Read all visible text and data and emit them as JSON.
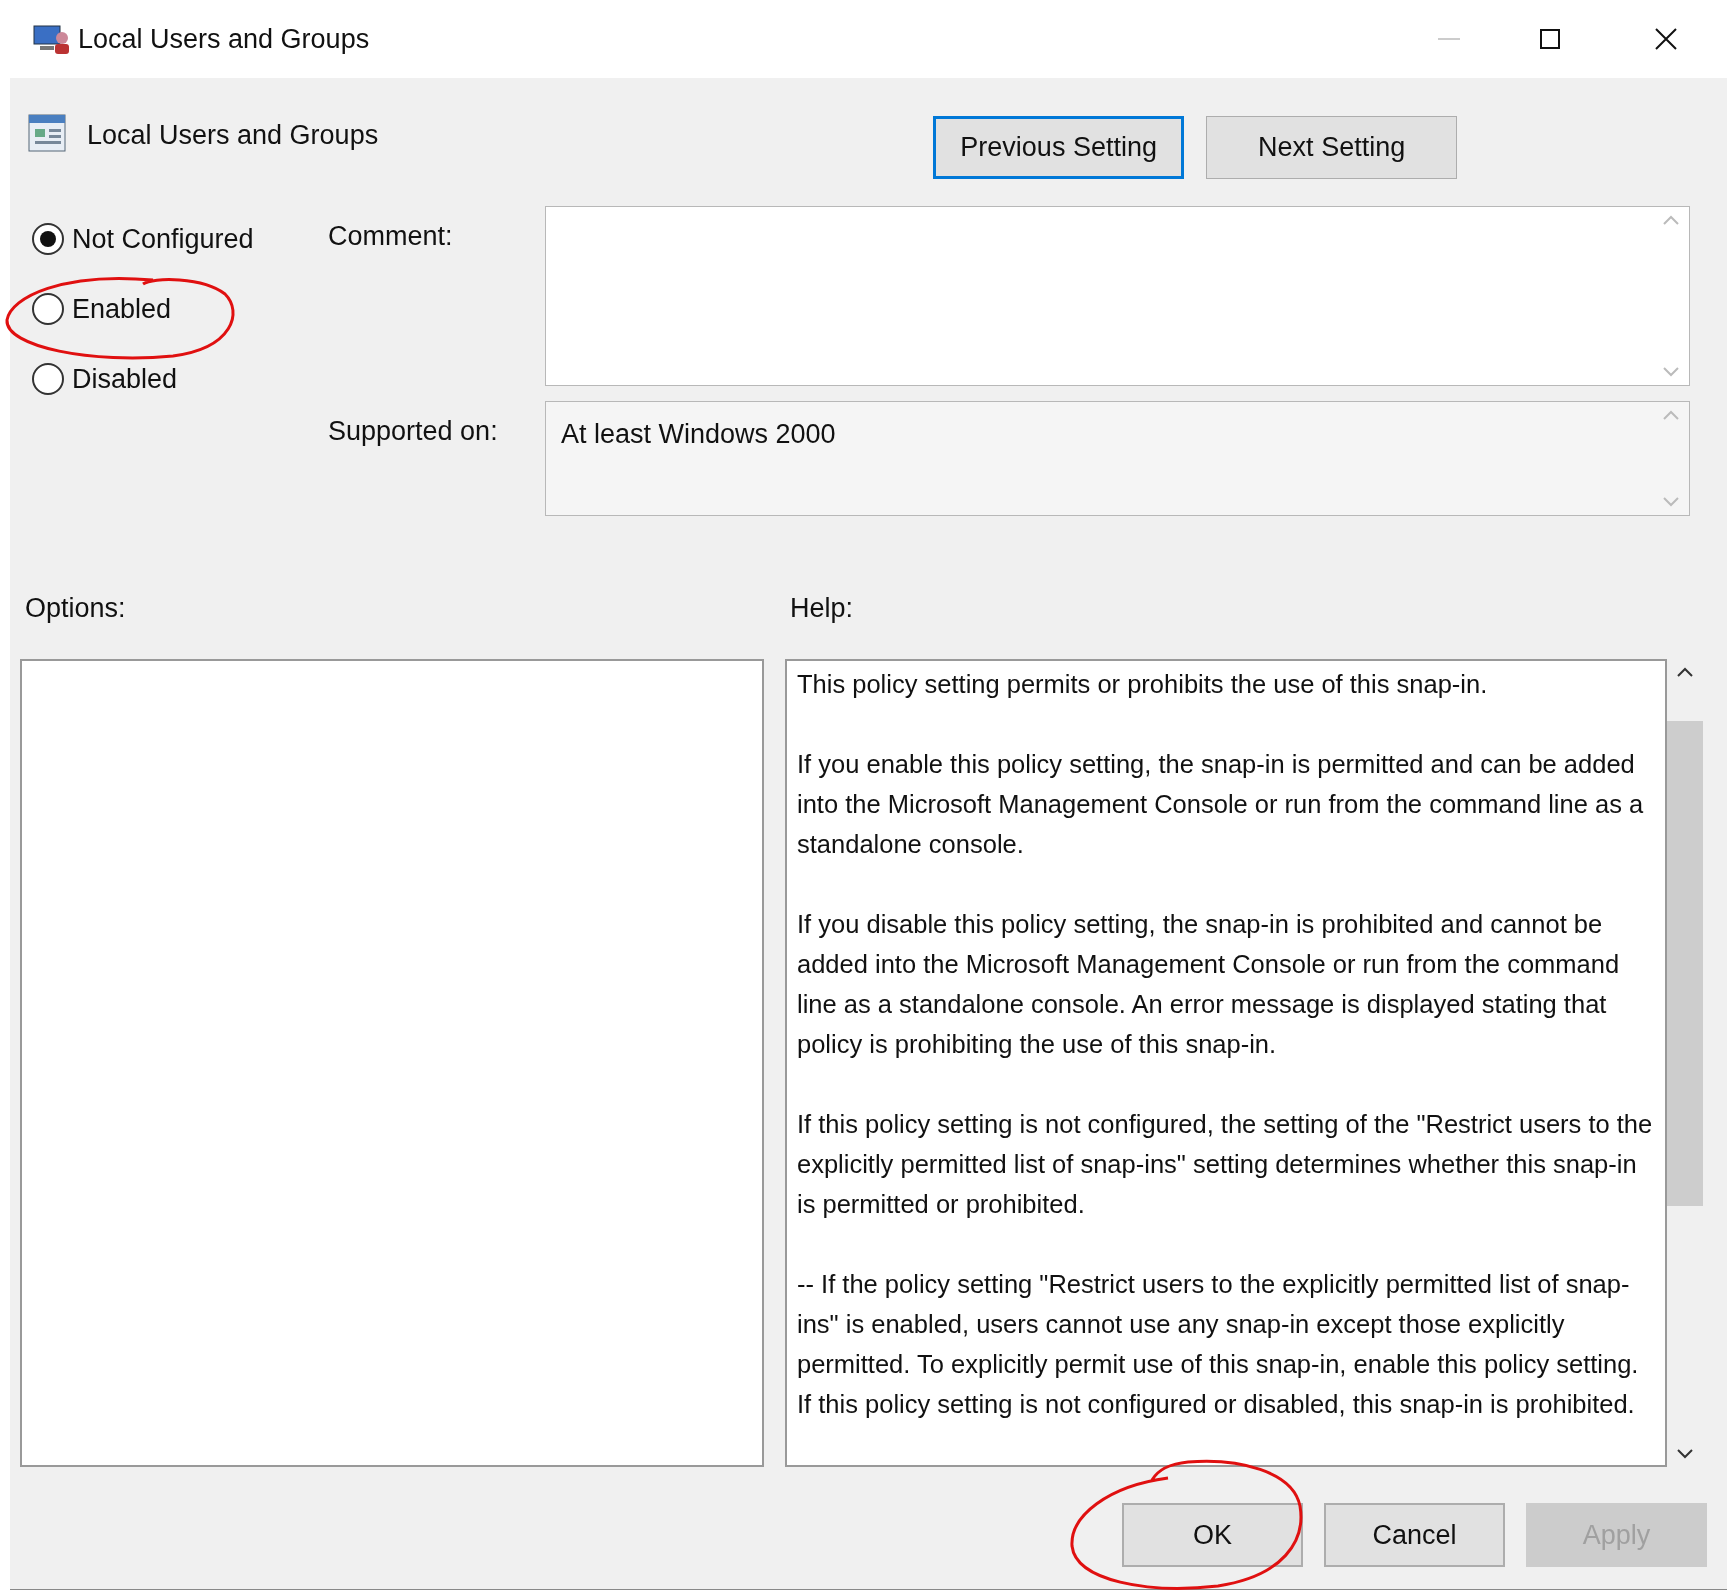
{
  "window": {
    "title": "Local Users and Groups"
  },
  "header": {
    "title": "Local Users and Groups"
  },
  "nav_buttons": [
    {
      "label": "Previous Setting",
      "focused": true
    },
    {
      "label": "Next Setting",
      "focused": false
    }
  ],
  "state_options": [
    {
      "label": "Not Configured",
      "selected": true
    },
    {
      "label": "Enabled",
      "selected": false
    },
    {
      "label": "Disabled",
      "selected": false
    }
  ],
  "comment": {
    "label": "Comment:"
  },
  "supported_on": {
    "label": "Supported on:",
    "value": "At least Windows 2000"
  },
  "options": {
    "label": "Options:"
  },
  "help": {
    "label": "Help:",
    "paragraphs": [
      "This policy setting permits or prohibits the use of this snap-in.",
      "If you enable this policy setting, the snap-in is permitted and can be added into the Microsoft Management Console or run from the command line as a standalone console.",
      "If you disable this policy setting, the snap-in is prohibited and cannot be added into the Microsoft Management Console or run from the command line as a standalone console. An error message is displayed stating that policy is prohibiting the use of this snap-in.",
      "If this policy setting is not configured, the setting of the \"Restrict users to the explicitly permitted list of snap-ins\" setting determines whether this snap-in is permitted or prohibited.",
      "--  If the policy setting \"Restrict users to the explicitly permitted list of snap-ins\" is enabled, users cannot use any snap-in except those explicitly permitted. To explicitly permit use of this snap-in, enable this policy setting. If this policy setting is not configured or disabled, this snap-in is prohibited."
    ]
  },
  "buttons": [
    {
      "label": "OK",
      "disabled": false
    },
    {
      "label": "Cancel",
      "disabled": false
    },
    {
      "label": "Apply",
      "disabled": true
    }
  ]
}
